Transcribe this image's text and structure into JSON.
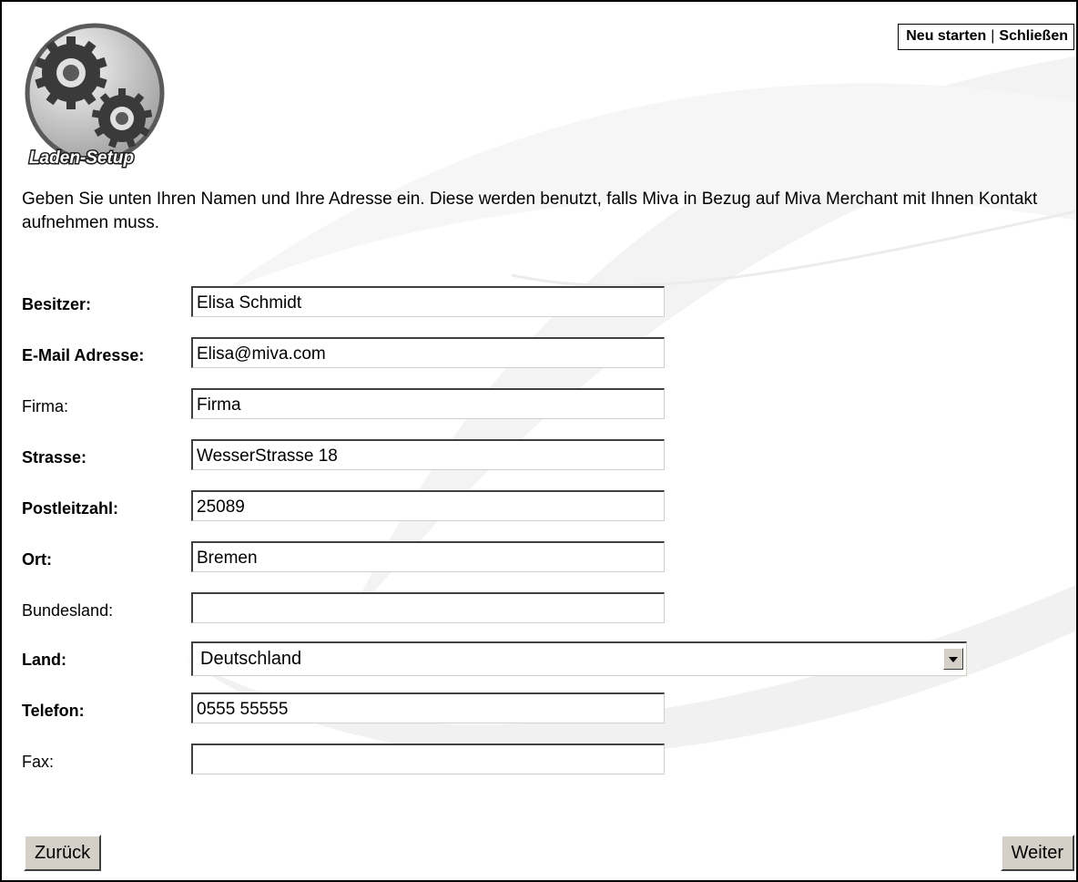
{
  "nav": {
    "restart_label": "Neu starten",
    "separator": "|",
    "close_label": "Schließen"
  },
  "logo": {
    "text": "Laden-Setup",
    "icon": "gears-icon"
  },
  "intro_text": "Geben Sie unten Ihren Namen und Ihre Adresse ein. Diese werden benutzt, falls Miva in Bezug auf Miva Merchant mit Ihnen Kontakt aufnehmen muss.",
  "form": {
    "owner": {
      "label": "Besitzer:",
      "value": "Elisa Schmidt"
    },
    "email": {
      "label": "E-Mail Adresse:",
      "value": "Elisa@miva.com"
    },
    "company": {
      "label": "Firma:",
      "value": "Firma"
    },
    "street": {
      "label": "Strasse:",
      "value": "WesserStrasse 18"
    },
    "zip": {
      "label": "Postleitzahl:",
      "value": "25089"
    },
    "city": {
      "label": "Ort:",
      "value": "Bremen"
    },
    "state": {
      "label": "Bundesland:",
      "value": ""
    },
    "country": {
      "label": "Land:",
      "value": "Deutschland"
    },
    "phone": {
      "label": "Telefon:",
      "value": "0555 55555"
    },
    "fax": {
      "label": "Fax:",
      "value": ""
    }
  },
  "buttons": {
    "back_label": "Zurück",
    "next_label": "Weiter"
  },
  "colors": {
    "button_face": "#d4d0c8",
    "field_border_dark": "#404040",
    "swoosh": "#f2f2f2"
  }
}
